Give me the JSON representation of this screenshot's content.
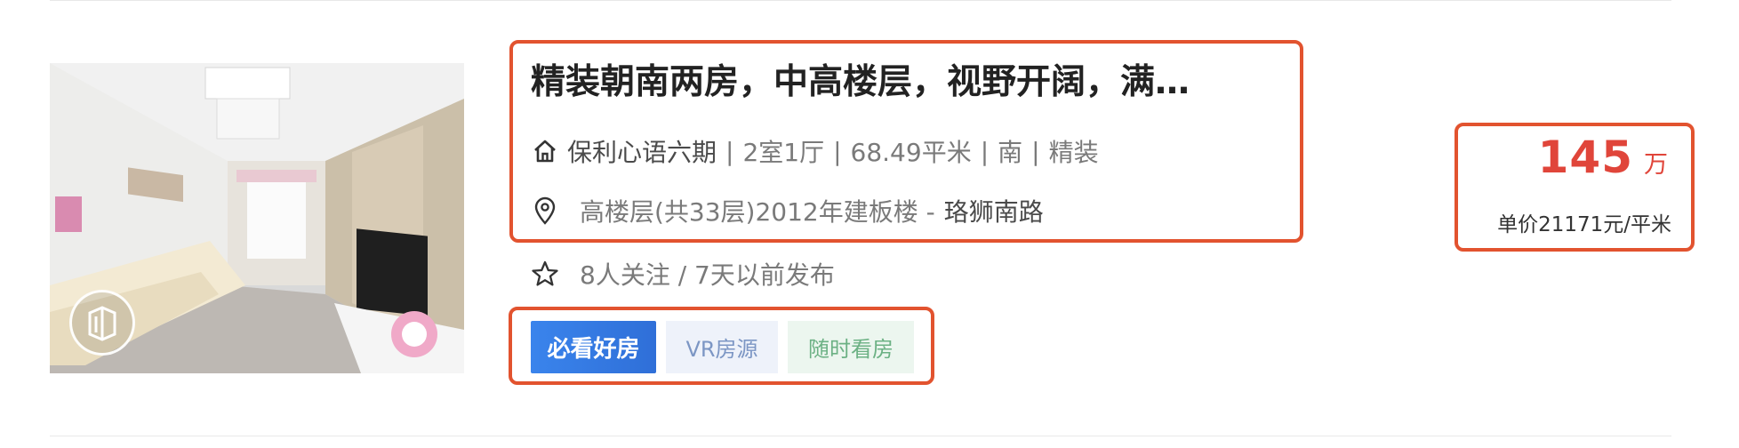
{
  "listing": {
    "title": "精装朝南两房，中高楼层，视野开阔，满…",
    "community": "保利心语六期",
    "attributes": [
      "2室1厅",
      "68.49平米",
      "南",
      "精装"
    ],
    "floor_info": "高楼层(共33层)2012年建板楼 -",
    "location": "珞狮南路",
    "followers": "8人关注 / 7天以前发布"
  },
  "tags": {
    "must_see": "必看好房",
    "vr": "VR房源",
    "anytime": "随时看房"
  },
  "price": {
    "total": "145",
    "total_unit": "万",
    "unit_price": "单价21171元/平米"
  },
  "colors": {
    "highlight": "#e2532f",
    "price": "#e0453a",
    "must_see_tag": "#2f6fd8",
    "vr_tag_text": "#7c96c4",
    "anytime_tag_text": "#6cb184"
  },
  "icons": {
    "thumbnail_badge": "vr-panorama-icon",
    "community": "house-icon",
    "location": "map-pin-icon",
    "follow": "star-icon"
  }
}
